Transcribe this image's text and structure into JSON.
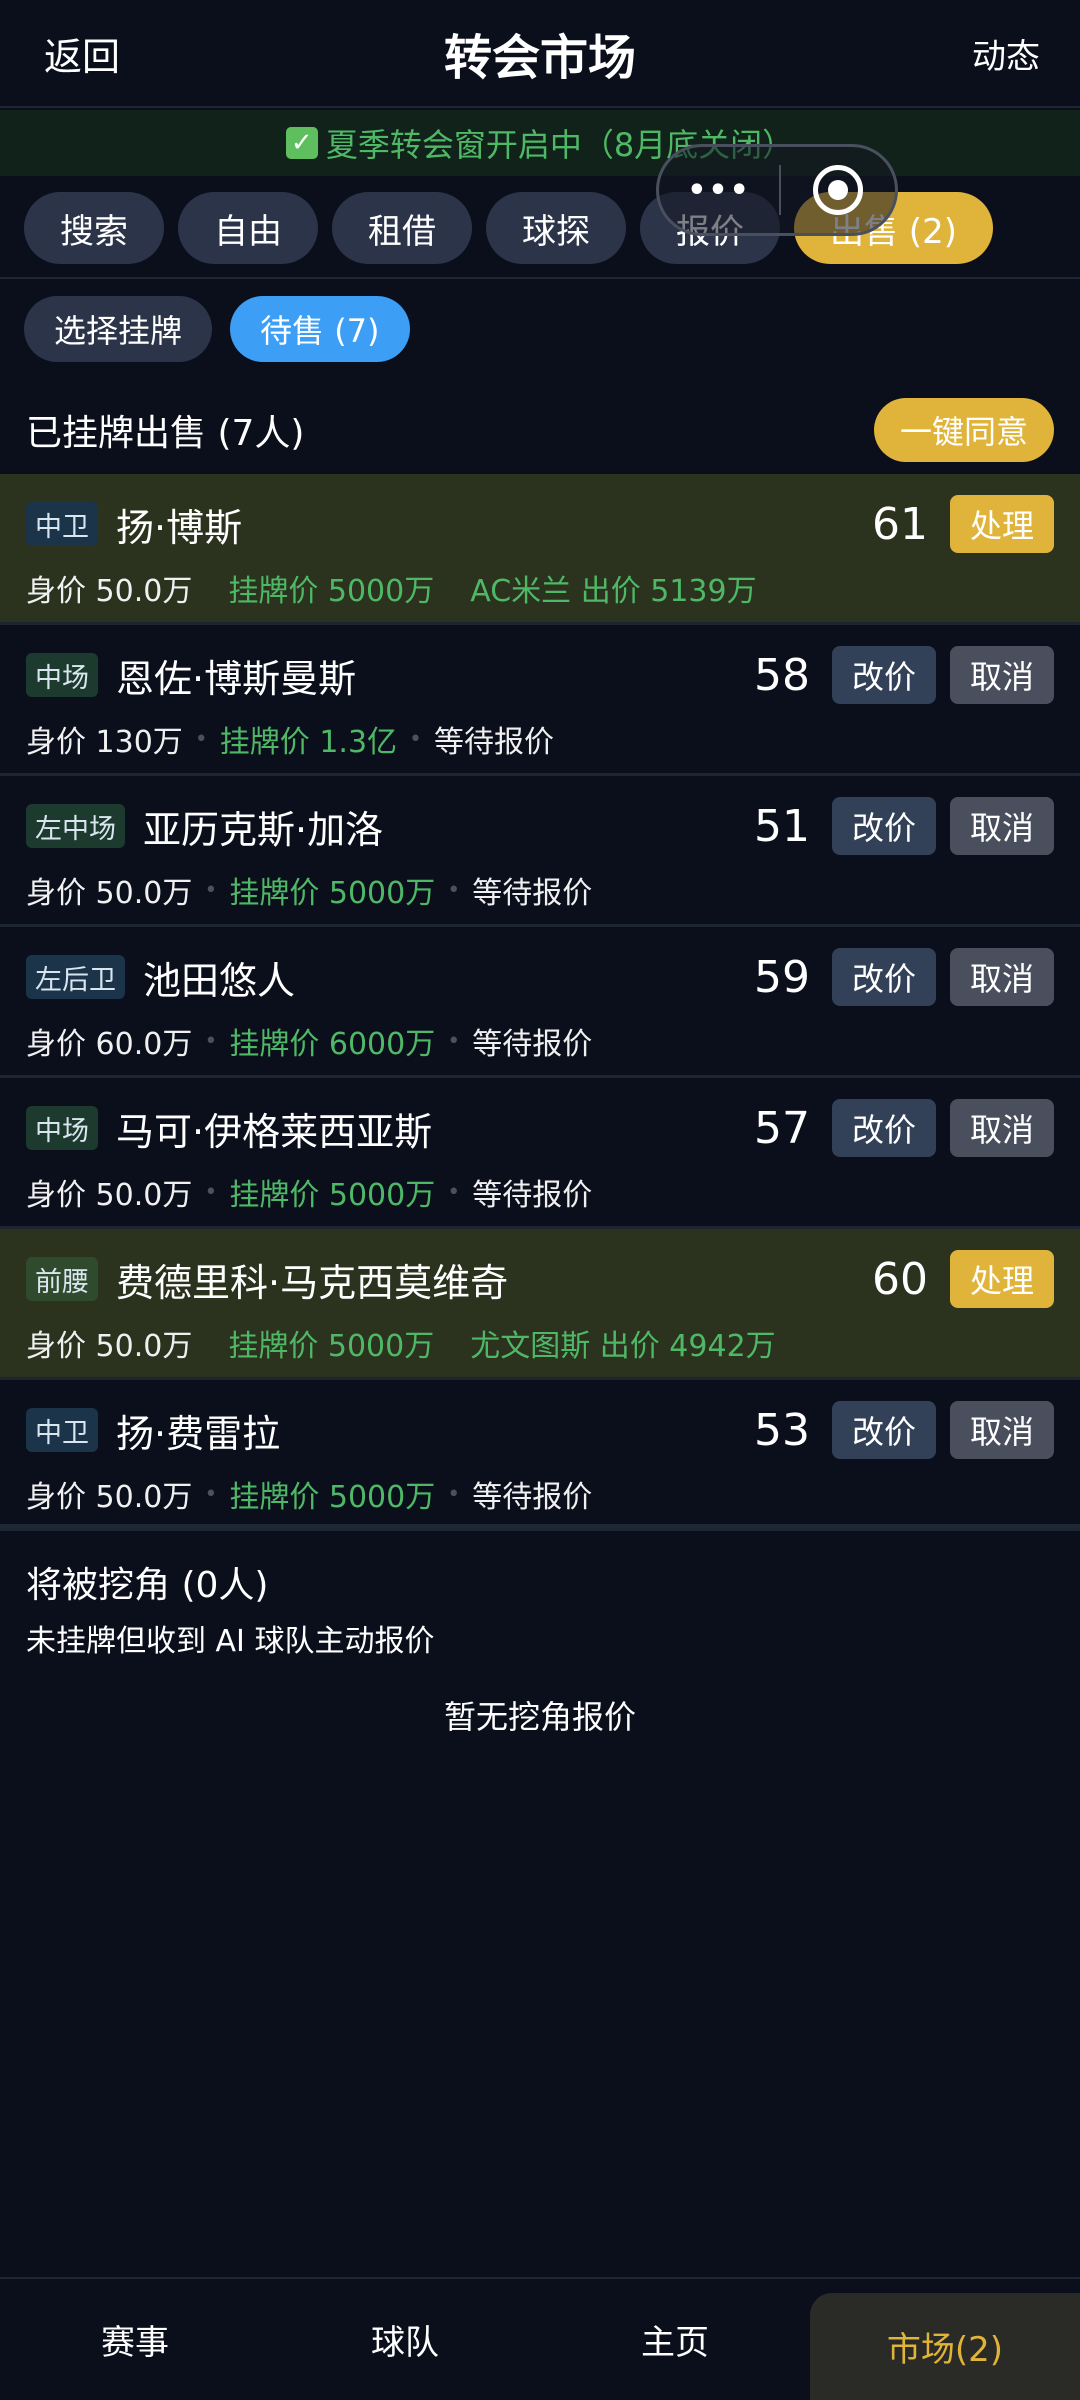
{
  "header": {
    "back_label": "返回",
    "title": "转会市场",
    "news_label": "动态"
  },
  "banner": {
    "text": "夏季转会窗开启中（8月底关闭）"
  },
  "tabs": [
    {
      "label": "搜索"
    },
    {
      "label": "自由"
    },
    {
      "label": "租借"
    },
    {
      "label": "球探"
    },
    {
      "label": "报价"
    },
    {
      "label": "出售 (2)"
    }
  ],
  "subtabs": [
    {
      "label": "选择挂牌"
    },
    {
      "label": "待售 (7)"
    }
  ],
  "listed": {
    "title": "已挂牌出售 (7人)",
    "agree_all_label": "一键同意",
    "process_label": "处理",
    "edit_label": "改价",
    "cancel_label": "取消",
    "players": [
      {
        "position": "中卫",
        "name": "扬·博斯",
        "rating": "61",
        "value": "身价 50.0万",
        "list_price": "挂牌价 5000万",
        "status": "AC米兰 出价 5139万"
      },
      {
        "position": "中场",
        "name": "恩佐·博斯曼斯",
        "rating": "58",
        "value": "身价 130万",
        "list_price": "挂牌价 1.3亿",
        "status": "等待报价"
      },
      {
        "position": "左中场",
        "name": "亚历克斯·加洛",
        "rating": "51",
        "value": "身价 50.0万",
        "list_price": "挂牌价 5000万",
        "status": "等待报价"
      },
      {
        "position": "左后卫",
        "name": "池田悠人",
        "rating": "59",
        "value": "身价 60.0万",
        "list_price": "挂牌价 6000万",
        "status": "等待报价"
      },
      {
        "position": "中场",
        "name": "马可·伊格莱西亚斯",
        "rating": "57",
        "value": "身价 50.0万",
        "list_price": "挂牌价 5000万",
        "status": "等待报价"
      },
      {
        "position": "前腰",
        "name": "费德里科·马克西莫维奇",
        "rating": "60",
        "value": "身价 50.0万",
        "list_price": "挂牌价 5000万",
        "status": "尤文图斯 出价 4942万"
      },
      {
        "position": "中卫",
        "name": "扬·费雷拉",
        "rating": "53",
        "value": "身价 50.0万",
        "list_price": "挂牌价 5000万",
        "status": "等待报价"
      }
    ]
  },
  "poach": {
    "title": "将被挖角 (0人)",
    "subtitle": "未挂牌但收到 AI 球队主动报价",
    "empty": "暂无挖角报价"
  },
  "bottom_nav": [
    {
      "label": "赛事"
    },
    {
      "label": "球队"
    },
    {
      "label": "主页"
    },
    {
      "label": "市场(2)"
    }
  ],
  "colors": {
    "accent_gold": "#e0b43a",
    "accent_blue": "#3d9ef5",
    "offer_green": "#4fb866",
    "background": "#0b0f1c"
  }
}
